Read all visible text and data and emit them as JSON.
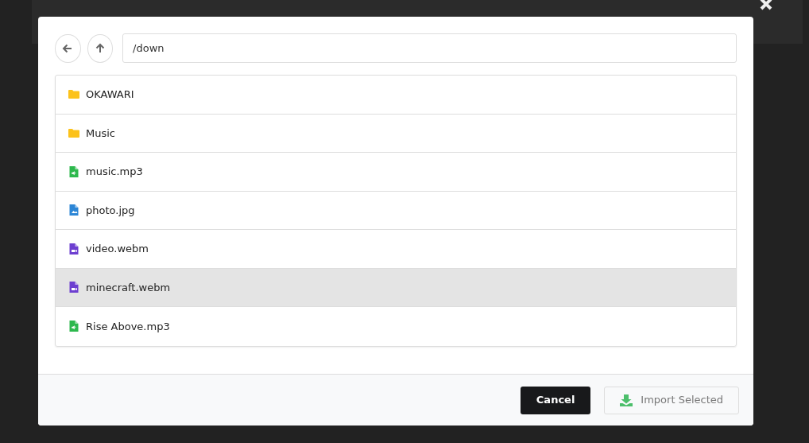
{
  "toolbar": {
    "path": "/down"
  },
  "items": [
    {
      "name": "OKAWARI",
      "kind": "folder",
      "selected": false
    },
    {
      "name": "Music",
      "kind": "folder",
      "selected": false
    },
    {
      "name": "music.mp3",
      "kind": "audio",
      "selected": false
    },
    {
      "name": "photo.jpg",
      "kind": "image",
      "selected": false
    },
    {
      "name": "video.webm",
      "kind": "video",
      "selected": false
    },
    {
      "name": "minecraft.webm",
      "kind": "video",
      "selected": true
    },
    {
      "name": "Rise Above.mp3",
      "kind": "audio",
      "selected": false
    }
  ],
  "footer": {
    "cancel": "Cancel",
    "import": {
      "label": "Import Selected",
      "disabled": true
    }
  }
}
